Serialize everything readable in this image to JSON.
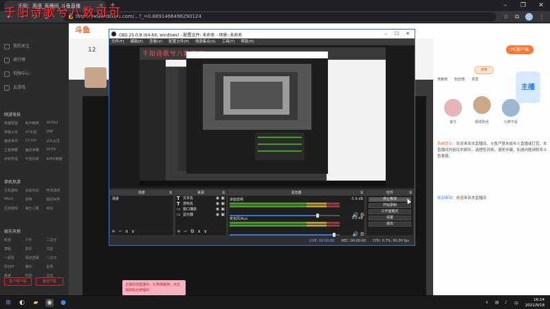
{
  "overlay": {
    "title": "千阳诗歌兮八数可可"
  },
  "browser": {
    "tab_title": "千阳：用语_直播间_斗鱼直播",
    "new_tab": "+",
    "url": "https://www.douyu.com/...?_=0.8891466496290124",
    "window_controls": [
      "–",
      "❐",
      "✕"
    ]
  },
  "site": {
    "logo": "斗鱼",
    "count": "12",
    "left_nav": {
      "top_items": [
        "我的关注",
        "排行榜",
        "视频中心",
        "云游戏"
      ],
      "sections": [
        {
          "head": "网游竞技",
          "items": [
            "英雄联盟",
            "和平精英",
            "DOTA2",
            "穿越火线",
            "CF手游",
            "DNF",
            "魔兽世界",
            "CS:GO",
            "LOL云顶",
            "王者荣耀",
            "魔兽争霸",
            "DOTA",
            "炉石传说",
            "守望先锋",
            "APEX英雄"
          ]
        },
        {
          "head": "单机热游",
          "items": [
            "主机游戏",
            "永劫无间",
            "怀旧游戏",
            "VALO",
            "原神",
            "我的世界",
            "互动游戏",
            "第五人格",
            "综合"
          ]
        },
        {
          "head": "娱乐天地",
          "items": [
            "颜值",
            "户外",
            "二次元",
            "舞蹈",
            "音乐",
            "交友",
            "一起看",
            "语音直播",
            "二次元",
            "原创IP",
            "娱乐",
            "星秀",
            "美食",
            "科技",
            "文化"
          ]
        }
      ],
      "btn_left": "客户端下载",
      "btn_right": "鱼吧下载"
    },
    "pink_notice": "主播在线直播中，礼物贡献榜，点击领取粉丝牌福利",
    "right_panel": {
      "badge": "PC客户端",
      "search": "搜索",
      "tabs": [
        "贡献榜",
        "粉丝榜",
        "贵宾"
      ],
      "fans": [
        {
          "name": "鱼丸",
          "color": "#e8b4b8"
        },
        {
          "name": "超级粉丝",
          "color": "#caa88a"
        },
        {
          "name": "九鹏不是",
          "color": "#9db6d2"
        }
      ],
      "mascot": "主播",
      "chat_label": "系统提示：",
      "chat_text": "欢迎来到本直播间，斗鱼严禁未成年人直播或打赏，本直播间内容仅供娱乐，请理性消费，谨防诈骗，如遇问题请联系斗鱼客服。",
      "chat2_user": "欢迎来到：",
      "chat2_text": "欢迎来到本直播间"
    }
  },
  "obs": {
    "title": "OBS 25.0.8 (64-bit, windows) - 配置文件: 未命名 - 场景: 未命名",
    "menu": [
      "文件(F)",
      "编辑(E)",
      "查看(V)",
      "配置文件(P)",
      "场景集合(S)",
      "工具(T)",
      "帮助(H)"
    ],
    "canvas_title": "千阳诗歌兮八数可可",
    "docks": {
      "scenes": {
        "title": "场景",
        "items": [
          "场景"
        ]
      },
      "sources": {
        "title": "来源",
        "items": [
          "文本名",
          "游戏名",
          "窗口捕获",
          "显示器"
        ]
      },
      "mixer": {
        "title": "混音器",
        "tracks": [
          {
            "name": "桌面音频",
            "db": "-5.9 dB",
            "volume": 0.8
          },
          {
            "name": "麦克风/Aux",
            "db": "0.0 dB",
            "volume": 0.95
          }
        ]
      },
      "controls": {
        "title": "控件",
        "buttons": [
          "停止推流",
          "开始录制",
          "工作室模式",
          "设置",
          "退出"
        ]
      }
    },
    "toolbar_glyphs": [
      "+",
      "−",
      "⚙",
      "∧",
      "∨"
    ],
    "status": {
      "live": "LIVE: 00:00:00",
      "rec": "REC: 00:00:00",
      "cpu": "CPU: 0.7%, 60.00 fps"
    }
  },
  "taskbar": {
    "time": "16:14",
    "date": "2021/9/18",
    "lang": "中"
  }
}
